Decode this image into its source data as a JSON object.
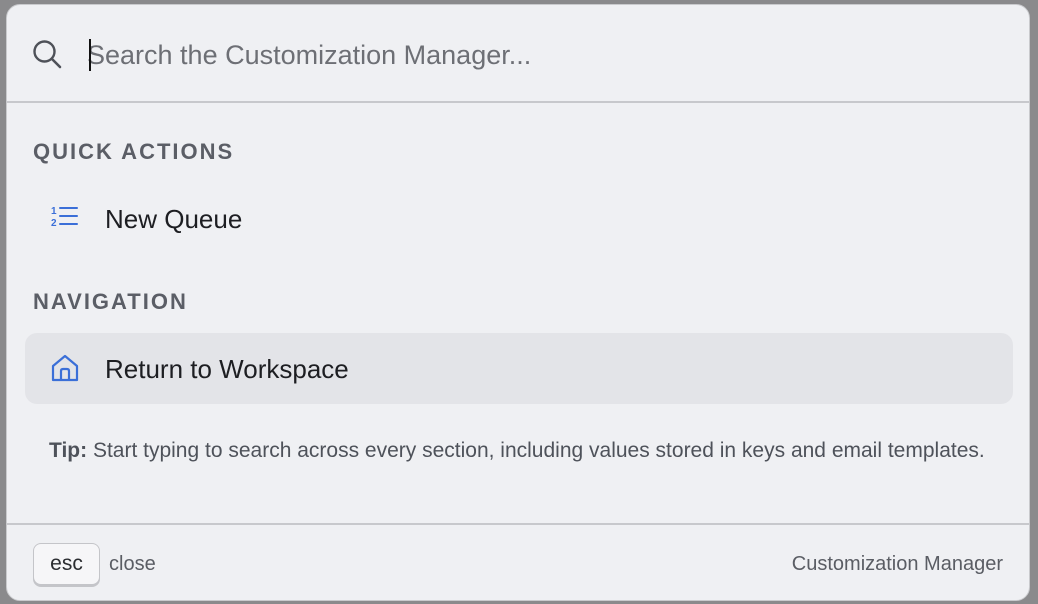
{
  "search": {
    "placeholder": "Search the Customization Manager..."
  },
  "sections": {
    "quick_actions": {
      "heading": "QUICK ACTIONS",
      "items": [
        {
          "label": "New Queue",
          "icon": "numbered-list-icon"
        }
      ]
    },
    "navigation": {
      "heading": "NAVIGATION",
      "items": [
        {
          "label": "Return to Workspace",
          "icon": "home-icon",
          "highlighted": true
        }
      ]
    }
  },
  "tip": {
    "prefix": "Tip:",
    "text": " Start typing to search across every section, including values stored in keys and email templates."
  },
  "footer": {
    "key": "esc",
    "key_action": "close",
    "title": "Customization Manager"
  },
  "colors": {
    "accent": "#3b6fd8",
    "panel_bg": "#eff0f3",
    "highlight_bg": "#e3e4e8",
    "heading_text": "#5b5e66"
  }
}
